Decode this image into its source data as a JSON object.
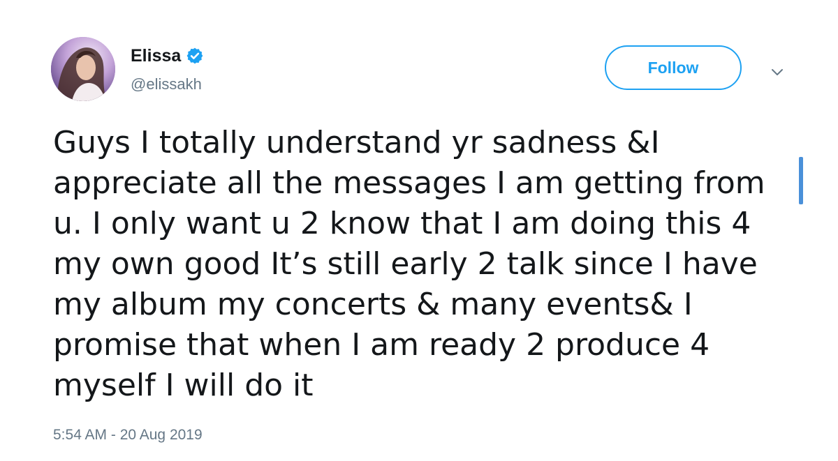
{
  "tweet": {
    "author": {
      "display_name": "Elissa",
      "handle": "@elissakh",
      "verified": true,
      "avatar_icon": "profile-photo"
    },
    "follow_label": "Follow",
    "more_icon": "chevron-down-icon",
    "text": "Guys I totally understand yr sadness &I\nappreciate all the messages I am getting from\nu. I only want u 2 know that I am doing this 4\nmy own good It’s still early 2 talk since I have\nmy album my concerts & many events& I\npromise that when I am ready 2 produce 4\nmyself I will do it",
    "timestamp": "5:54 AM - 20 Aug 2019"
  },
  "colors": {
    "accent": "#1da1f2",
    "secondary_text": "#657786",
    "primary_text": "#14171a",
    "scroll_indicator": "#4a90d9"
  }
}
